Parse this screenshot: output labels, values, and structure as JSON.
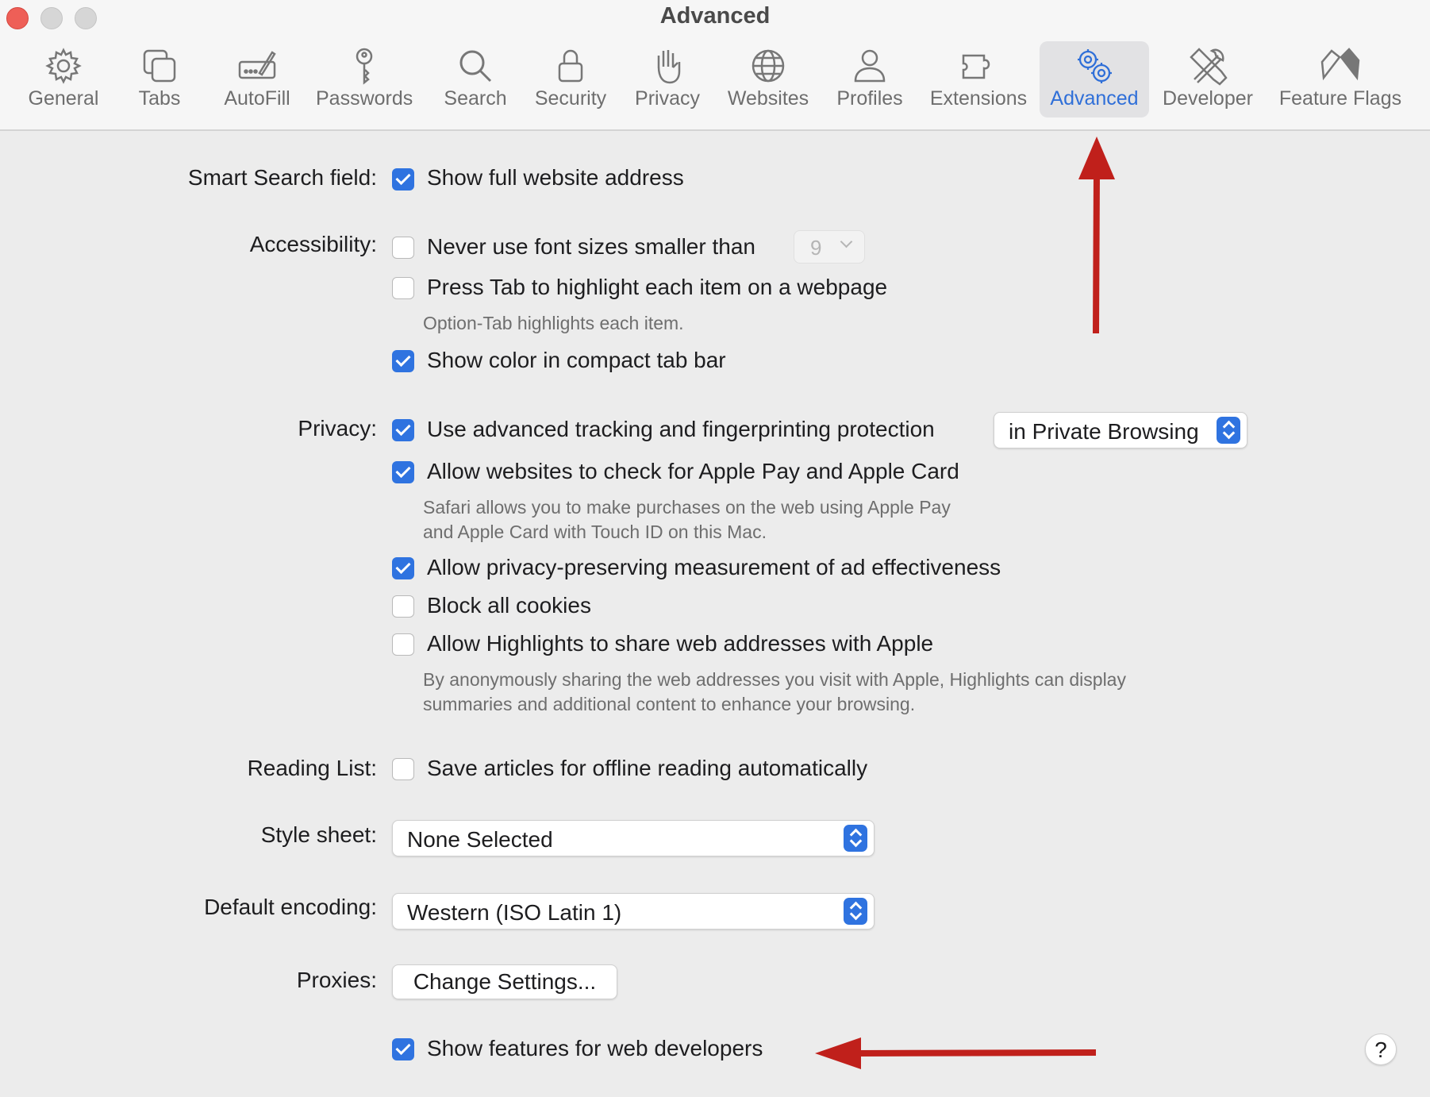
{
  "window": {
    "title": "Advanced"
  },
  "tabs": [
    {
      "label": "General",
      "icon": "gear-icon"
    },
    {
      "label": "Tabs",
      "icon": "tabs-icon"
    },
    {
      "label": "AutoFill",
      "icon": "autofill-icon"
    },
    {
      "label": "Passwords",
      "icon": "key-icon"
    },
    {
      "label": "Search",
      "icon": "search-icon"
    },
    {
      "label": "Security",
      "icon": "lock-icon"
    },
    {
      "label": "Privacy",
      "icon": "hand-icon"
    },
    {
      "label": "Websites",
      "icon": "globe-icon"
    },
    {
      "label": "Profiles",
      "icon": "person-icon"
    },
    {
      "label": "Extensions",
      "icon": "puzzle-icon"
    },
    {
      "label": "Advanced",
      "icon": "gears-icon",
      "active": true
    },
    {
      "label": "Developer",
      "icon": "tools-icon"
    },
    {
      "label": "Feature Flags",
      "icon": "flags-icon"
    }
  ],
  "smart_search": {
    "label": "Smart Search field:",
    "show_full_address": {
      "label": "Show full website address",
      "checked": true
    }
  },
  "accessibility": {
    "label": "Accessibility:",
    "min_font": {
      "label": "Never use font sizes smaller than",
      "checked": false,
      "value": "9"
    },
    "press_tab": {
      "label": "Press Tab to highlight each item on a webpage",
      "checked": false
    },
    "press_tab_note": "Option-Tab highlights each item.",
    "compact_color": {
      "label": "Show color in compact tab bar",
      "checked": true
    }
  },
  "privacy": {
    "label": "Privacy:",
    "tracking": {
      "label": "Use advanced tracking and fingerprinting protection",
      "checked": true,
      "mode": "in Private Browsing"
    },
    "apple_pay": {
      "label": "Allow websites to check for Apple Pay and Apple Card",
      "checked": true
    },
    "apple_pay_note_1": "Safari allows you to make purchases on the web using Apple Pay",
    "apple_pay_note_2": "and Apple Card with Touch ID on this Mac.",
    "ad_measurement": {
      "label": "Allow privacy-preserving measurement of ad effectiveness",
      "checked": true
    },
    "block_cookies": {
      "label": "Block all cookies",
      "checked": false
    },
    "highlights": {
      "label": "Allow Highlights to share web addresses with Apple",
      "checked": false
    },
    "highlights_note_1": "By anonymously sharing the web addresses you visit with Apple, Highlights can display",
    "highlights_note_2": "summaries and additional content to enhance your browsing."
  },
  "reading_list": {
    "label": "Reading List:",
    "offline": {
      "label": "Save articles for offline reading automatically",
      "checked": false
    }
  },
  "style_sheet": {
    "label": "Style sheet:",
    "value": "None Selected"
  },
  "encoding": {
    "label": "Default encoding:",
    "value": "Western (ISO Latin 1)"
  },
  "proxies": {
    "label": "Proxies:",
    "button": "Change Settings..."
  },
  "developer": {
    "label": "Show features for web developers",
    "checked": true
  },
  "help": {
    "label": "?"
  },
  "colors": {
    "accent": "#2f73e0",
    "annotation_arrow": "#c0201b"
  }
}
